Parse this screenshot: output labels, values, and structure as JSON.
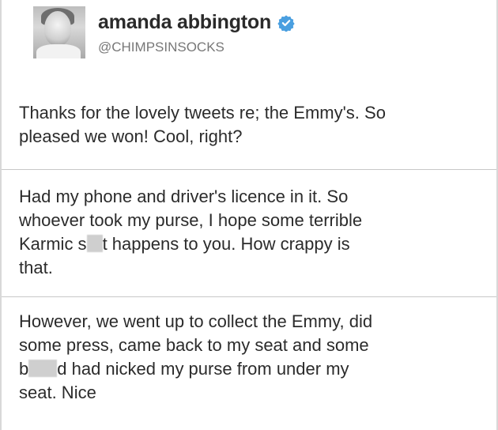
{
  "profile": {
    "display_name": "amanda abbington",
    "handle": "@CHIMPSINSOCKS",
    "verified_icon": "verified-badge-icon",
    "verified_color": "#4a9fe0"
  },
  "tweets": [
    {
      "lines": [
        "Thanks for the lovely tweets re; the Emmy's. So",
        "pleased we won! Cool, right?"
      ]
    },
    {
      "lines": [
        "Had my phone and driver's licence in it. So",
        "whoever took my purse, I hope some terrible",
        "that."
      ],
      "line3_before": "Karmic s",
      "line3_after": "t happens to you. How crappy is"
    },
    {
      "lines": [
        "However, we went up to collect the Emmy, did",
        "some press, came back to my seat and some",
        "seat. Nice"
      ],
      "line3_before": "b",
      "line3_after": "d had nicked my purse from under my"
    }
  ]
}
